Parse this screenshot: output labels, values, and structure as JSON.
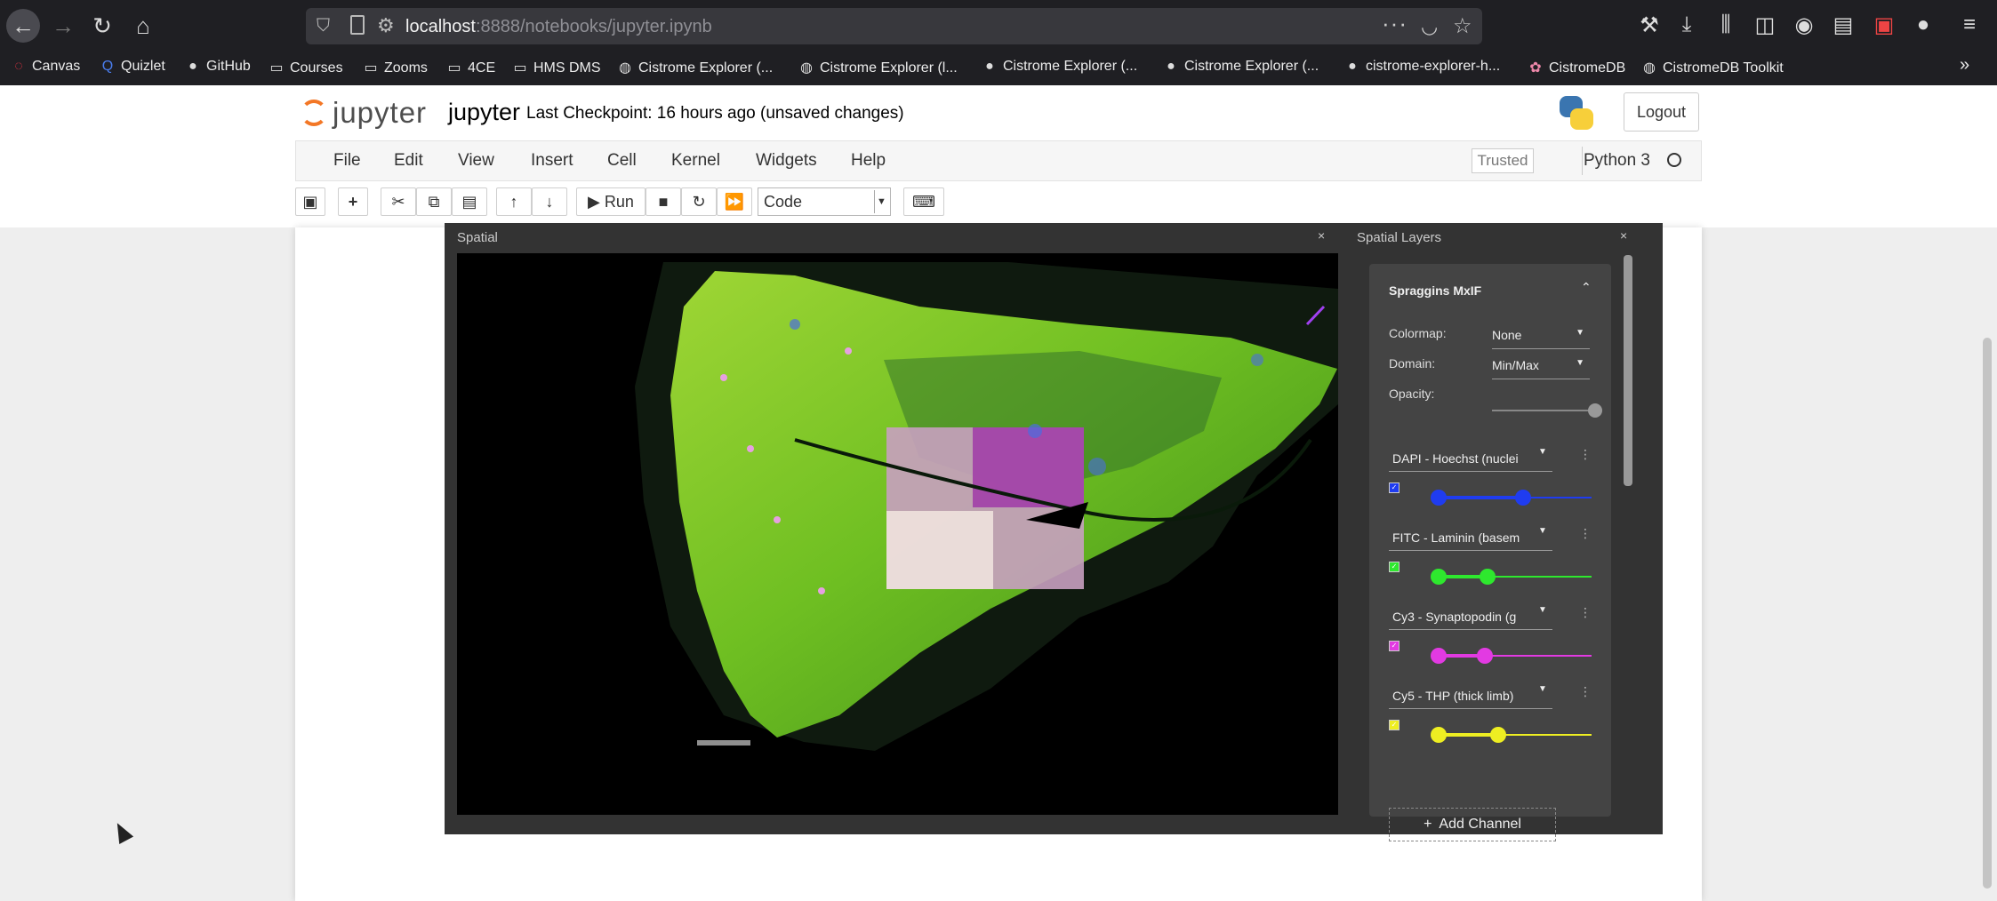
{
  "browser": {
    "url_host": "localhost",
    "url_rest": ":8888/notebooks/jupyter.ipynb",
    "bookmarks": [
      "Canvas",
      "Quizlet",
      "GitHub",
      "Courses",
      "Zooms",
      "4CE",
      "HMS DMS",
      "Cistrome Explorer (...",
      "Cistrome Explorer (l...",
      "Cistrome Explorer (...",
      "Cistrome Explorer (...",
      "cistrome-explorer-h...",
      "CistromeDB",
      "CistromeDB Toolkit"
    ]
  },
  "header": {
    "logo_text": "jupyter",
    "notebook_name": "jupyter",
    "checkpoint": "Last Checkpoint: 16 hours ago",
    "status": "(unsaved changes)",
    "logout": "Logout"
  },
  "menubar": {
    "items": [
      "File",
      "Edit",
      "View",
      "Insert",
      "Cell",
      "Kernel",
      "Widgets",
      "Help"
    ],
    "trusted": "Trusted",
    "kernel": "Python 3"
  },
  "toolbar": {
    "run_label": "Run",
    "cell_type": "Code"
  },
  "spatial": {
    "title": "Spatial",
    "close": "×"
  },
  "layers": {
    "title": "Spatial Layers",
    "close": "×",
    "layer_name": "Spraggins MxIF",
    "colormap_label": "Colormap:",
    "colormap_value": "None",
    "domain_label": "Domain:",
    "domain_value": "Min/Max",
    "opacity_label": "Opacity:",
    "opacity_value": 1.0,
    "channels": [
      {
        "name": "DAPI - Hoechst (nuclei",
        "color": "#1f3cf0",
        "range": [
          0.0,
          0.55
        ]
      },
      {
        "name": "FITC - Laminin (basem",
        "color": "#2ee82e",
        "range": [
          0.0,
          0.32
        ]
      },
      {
        "name": "Cy3 - Synaptopodin (g",
        "color": "#e23ae2",
        "range": [
          0.0,
          0.3
        ]
      },
      {
        "name": "Cy5 - THP (thick limb)",
        "color": "#eeee22",
        "range": [
          0.0,
          0.39
        ]
      }
    ],
    "add_channel": "Add Channel"
  }
}
